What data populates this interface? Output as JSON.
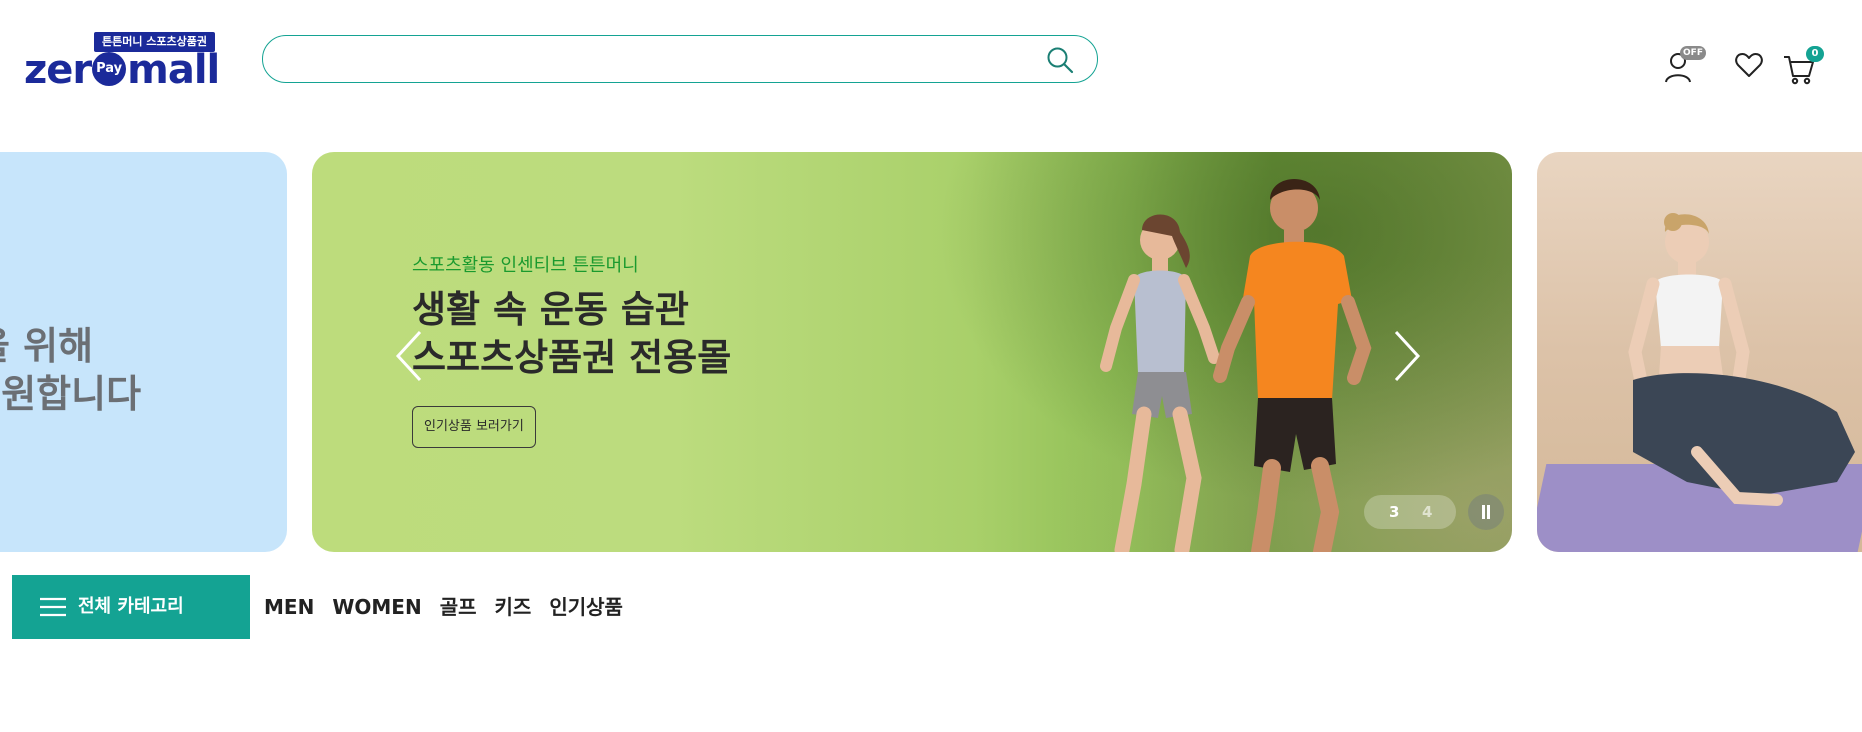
{
  "header": {
    "logo": {
      "tagline": "튼튼머니 스포츠상품권",
      "word_prefix": "zer",
      "badge": "Pay",
      "word_suffix": "mall"
    },
    "search": {
      "value": "",
      "placeholder": "",
      "icon": "search-icon"
    },
    "user": {
      "icon": "user-icon",
      "badge": "OFF"
    },
    "wishlist": {
      "icon": "heart-icon"
    },
    "cart": {
      "icon": "cart-icon",
      "count": "0"
    }
  },
  "banner": {
    "prev_slide": {
      "lines": [
        "상을 위해",
        "l 응원합니다"
      ]
    },
    "current": {
      "subtitle": "스포츠활동 인센티브 튼튼머니",
      "title_line1": "생활 속 운동 습관",
      "title_line2": "스포츠상품권 전용몰",
      "cta": "인기상품 보러가기"
    },
    "pager": {
      "current": "3",
      "next": "4"
    },
    "controls": {
      "prev_icon": "chevron-left-icon",
      "next_icon": "chevron-right-icon",
      "pause_icon": "pause-icon"
    }
  },
  "category_nav": {
    "all_label": "전체 카테고리",
    "links": [
      "MEN",
      "WOMEN",
      "골프",
      "키즈",
      "인기상품"
    ]
  },
  "colors": {
    "brand": "#1b2a9a",
    "accent": "#14a393",
    "subtitle": "#1a9a2e"
  }
}
